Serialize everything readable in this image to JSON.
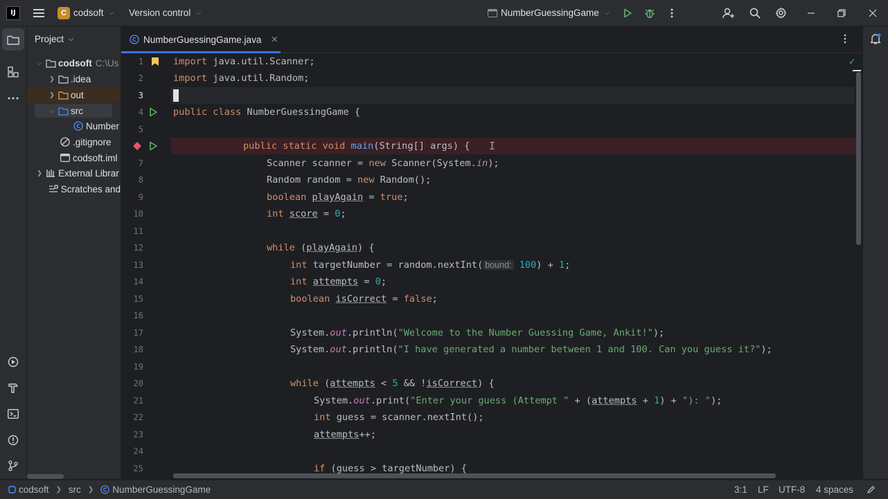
{
  "titlebar": {
    "ide_logo": "IJ",
    "project_badge": "C",
    "project_name": "codsoft",
    "vcs_menu": "Version control",
    "run_config": "NumberGuessingGame"
  },
  "project_panel": {
    "title": "Project",
    "tree": [
      {
        "label": "codsoft",
        "path": "C:\\Us",
        "icon": "folder-icon"
      },
      {
        "label": ".idea",
        "icon": "folder-icon"
      },
      {
        "label": "out",
        "icon": "folder-icon"
      },
      {
        "label": "src",
        "icon": "folder-icon"
      },
      {
        "label": "Number",
        "icon": "java-class-icon"
      },
      {
        "label": ".gitignore",
        "icon": "gitignore-icon"
      },
      {
        "label": "codsoft.iml",
        "icon": "module-file-icon"
      },
      {
        "label": "External Librar",
        "icon": "library-icon"
      },
      {
        "label": "Scratches and",
        "icon": "scratches-icon"
      }
    ]
  },
  "editor": {
    "tab_label": "NumberGuessingGame.java",
    "line_numbers": [
      "1",
      "2",
      "3",
      "4",
      "5",
      "6",
      "7",
      "8",
      "9",
      "10",
      "11",
      "12",
      "13",
      "14",
      "15",
      "16",
      "17",
      "18",
      "19",
      "20",
      "21",
      "22",
      "23",
      "24",
      "25"
    ],
    "inlay_hint": "bound:",
    "code": {
      "l1_kw": "import",
      "l1_rest": " java.util.Scanner;",
      "l2_kw": "import",
      "l2_rest": " java.util.Random;",
      "l4_kw": "public class",
      "l4_rest": " NumberGuessingGame {",
      "l6_kw": "public static void",
      "l6_fn": "main",
      "l6_rest": "(String[] args) {",
      "l7_a": "Scanner scanner = ",
      "l7_kw": "new",
      "l7_b": " Scanner(System.",
      "l7_fld": "in",
      "l7_c": ");",
      "l8_a": "Random random = ",
      "l8_kw": "new",
      "l8_b": " Random();",
      "l9_kw": "boolean",
      "l9_var": "playAgain",
      "l9_eq": " = ",
      "l9_val": "true",
      "l9_end": ";",
      "l10_kw": "int",
      "l10_var": "score",
      "l10_eq": " = ",
      "l10_val": "0",
      "l10_end": ";",
      "l12_kw": "while",
      "l12_a": " (",
      "l12_var": "playAgain",
      "l12_b": ") {",
      "l13_kw": "int",
      "l13_a": " targetNumber = random.nextInt(",
      "l13_num": "100",
      "l13_b": ") + ",
      "l13_num2": "1",
      "l13_c": ";",
      "l14_kw": "int",
      "l14_var": "attempts",
      "l14_eq": " = ",
      "l14_val": "0",
      "l14_end": ";",
      "l15_kw": "boolean",
      "l15_var": "isCorrect",
      "l15_eq": " = ",
      "l15_val": "false",
      "l15_end": ";",
      "l17_a": "System.",
      "l17_fld": "out",
      "l17_b": ".println(",
      "l17_str": "\"Welcome to the Number Guessing Game, Ankit!\"",
      "l17_c": ");",
      "l18_a": "System.",
      "l18_fld": "out",
      "l18_b": ".println(",
      "l18_str": "\"I have generated a number between 1 and 100. Can you guess it?\"",
      "l18_c": ");",
      "l20_kw": "while",
      "l20_a": " (",
      "l20_var": "attempts",
      "l20_b": " < ",
      "l20_num": "5",
      "l20_c": " && !",
      "l20_var2": "isCorrect",
      "l20_d": ") {",
      "l21_a": "System.",
      "l21_fld": "out",
      "l21_b": ".print(",
      "l21_str": "\"Enter your guess (Attempt \"",
      "l21_c": " + (",
      "l21_var": "attempts",
      "l21_d": " + ",
      "l21_num": "1",
      "l21_e": ") + ",
      "l21_str2": "\"): \"",
      "l21_f": ");",
      "l22_kw": "int",
      "l22_a": " guess = scanner.nextInt();",
      "l23_var": "attempts",
      "l23_a": "++;",
      "l25_kw": "if",
      "l25_a": " (guess > targetNumber) {"
    }
  },
  "statusbar": {
    "crumb_project": "codsoft",
    "crumb_src": "src",
    "crumb_class": "NumberGuessingGame",
    "position": "3:1",
    "line_sep": "LF",
    "encoding": "UTF-8",
    "indent": "4 spaces"
  },
  "colors": {
    "accent": "#3574f0",
    "keyword": "#cf8e6d",
    "function": "#56a8f5",
    "string": "#6aab73",
    "number": "#2aacb8",
    "field": "#c77dbb",
    "breakpoint_line": "#3a2024"
  }
}
